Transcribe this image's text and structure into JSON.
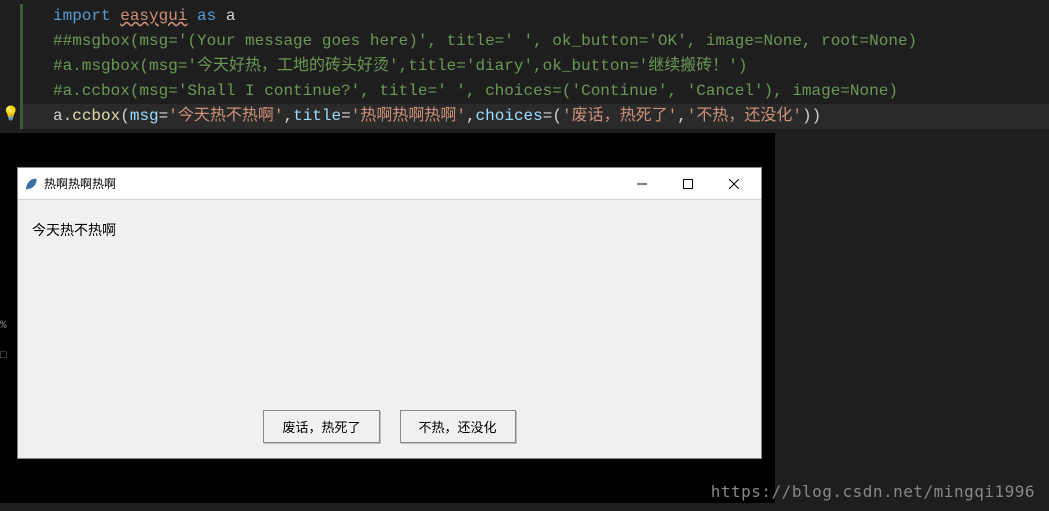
{
  "code": {
    "line1": {
      "import": "import",
      "module": "easygui",
      "as": "as",
      "alias": "a"
    },
    "line2": "##msgbox(msg='(Your message goes here)', title=' ', ok_button='OK', image=None, root=None)",
    "line3": "#a.msgbox(msg='今天好热，工地的砖头好烫',title='diary',ok_button='继续搬砖！')",
    "line4": "#a.ccbox(msg='Shall I continue?', title=' ', choices=('Continue', 'Cancel'), image=None)",
    "line5": {
      "obj": "a",
      "dot": ".",
      "func": "ccbox",
      "open": "(",
      "p1": "msg",
      "eq": "=",
      "s1": "'今天热不热啊'",
      "c1": ",",
      "p2": "title",
      "s2": "'热啊热啊热啊'",
      "c2": ",",
      "p3": "choices",
      "copen": "=(",
      "s3": "'废话，热死了'",
      "c3": ",",
      "s4": "'不热，还没化'",
      "close": "))"
    }
  },
  "dialog": {
    "title": "热啊热啊热啊",
    "message": "今天热不热啊",
    "button1": "废话，热死了",
    "button2": "不热，还没化"
  },
  "leftstrip": {
    "percent": "%",
    "other": "□"
  },
  "watermark": "https://blog.csdn.net/mingqi1996"
}
